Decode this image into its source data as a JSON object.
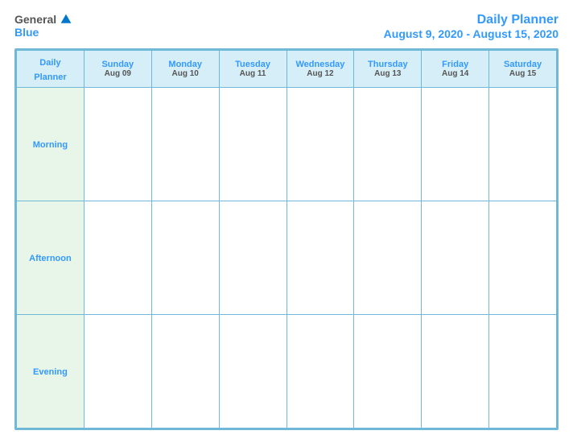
{
  "header": {
    "logo": {
      "general": "General",
      "blue": "Blue",
      "tagline": ""
    },
    "title": "Daily Planner",
    "date_range": "August 9, 2020 - August 15, 2020"
  },
  "table": {
    "label_header_line1": "Daily",
    "label_header_line2": "Planner",
    "columns": [
      {
        "day": "Sunday",
        "date": "Aug 09"
      },
      {
        "day": "Monday",
        "date": "Aug 10"
      },
      {
        "day": "Tuesday",
        "date": "Aug 11"
      },
      {
        "day": "Wednesday",
        "date": "Aug 12"
      },
      {
        "day": "Thursday",
        "date": "Aug 13"
      },
      {
        "day": "Friday",
        "date": "Aug 14"
      },
      {
        "day": "Saturday",
        "date": "Aug 15"
      }
    ],
    "rows": [
      {
        "label": "Morning"
      },
      {
        "label": "Afternoon"
      },
      {
        "label": "Evening"
      }
    ]
  }
}
